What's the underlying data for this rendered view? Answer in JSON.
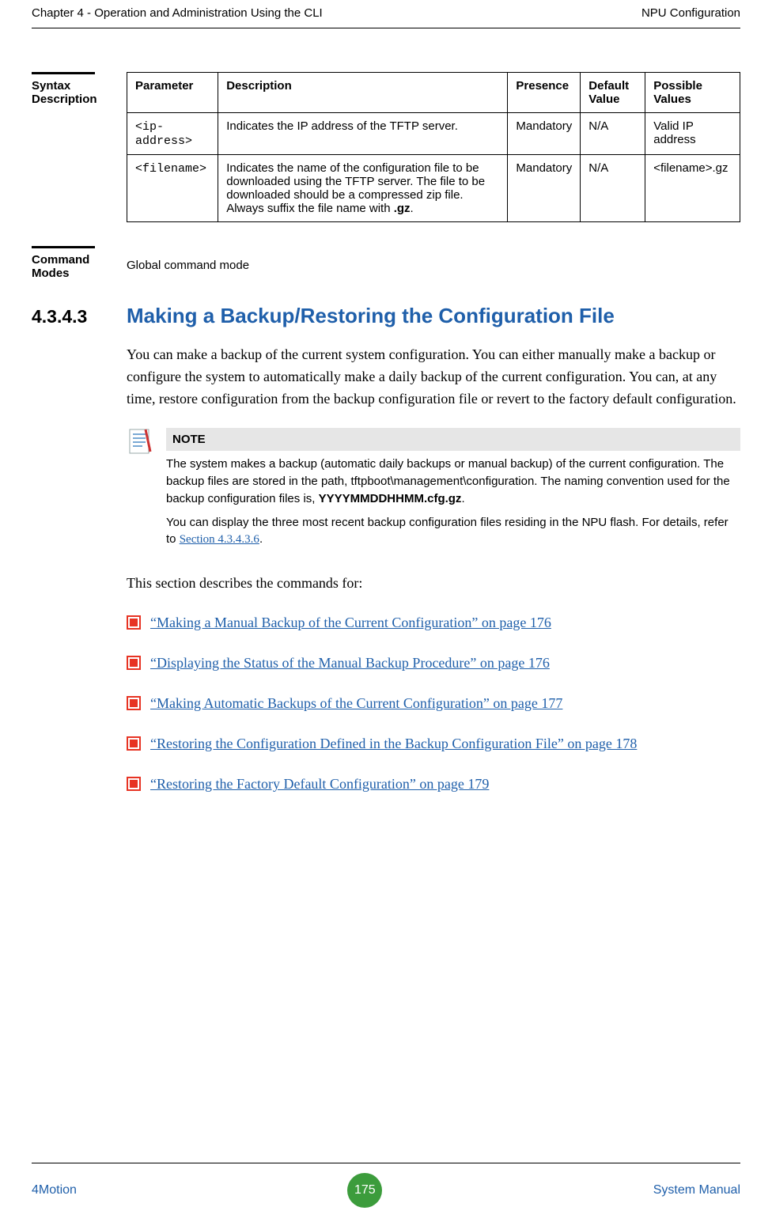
{
  "header": {
    "left": "Chapter 4 - Operation and Administration Using the CLI",
    "right": "NPU Configuration"
  },
  "syntax_label": "Syntax Description",
  "table": {
    "headers": {
      "col1": "Parameter",
      "col2": "Description",
      "col3": "Presence",
      "col4": "Default Value",
      "col5": "Possible Values"
    },
    "rows": [
      {
        "c1": "<ip-address>",
        "c2": "Indicates the IP address of the TFTP server.",
        "c3": "Mandatory",
        "c4": "N/A",
        "c5": "Valid IP address"
      },
      {
        "c1": "<filename>",
        "c2_a": "Indicates the name of the configuration file to be downloaded using the TFTP server. The file to be downloaded should be a compressed zip file. Always suffix the file name with ",
        "c2_b": ".gz",
        "c2_c": ".",
        "c3": "Mandatory",
        "c4": "N/A",
        "c5": "<filename>.gz"
      }
    ]
  },
  "command_modes_label": "Command Modes",
  "command_modes_value": "Global command mode",
  "section": {
    "num": "4.3.4.3",
    "title": "Making a Backup/Restoring the Configuration File"
  },
  "para1": "You can make a backup of the current system configuration. You can either manually make a backup or configure the system to automatically make a daily backup of the current configuration. You can, at any time, restore configuration from the backup configuration file or revert to the factory default configuration.",
  "note": {
    "label": "NOTE",
    "p1_a": "The system makes a backup (automatic daily backups or manual backup) of the current configuration. The backup files are stored in the path, tftpboot\\management\\configuration. The naming convention used for the backup configuration files is, ",
    "p1_b": "YYYYMMDDHHMM.cfg.gz",
    "p1_c": ".",
    "p2_a": "You can display the three most recent backup configuration files residing in the NPU flash. For details, refer to ",
    "p2_link": "Section 4.3.4.3.6",
    "p2_c": "."
  },
  "para2": "This section describes the commands for:",
  "list_items": [
    "“Making a Manual Backup of the Current Configuration” on page 176",
    "“Displaying the Status of the Manual Backup Procedure” on page 176",
    "“Making Automatic Backups of the Current Configuration” on page 177",
    "“Restoring the Configuration Defined in the Backup Configuration File” on page 178",
    "“Restoring the Factory Default Configuration” on page 179"
  ],
  "footer": {
    "left": "4Motion",
    "page": "175",
    "right": "System Manual"
  }
}
